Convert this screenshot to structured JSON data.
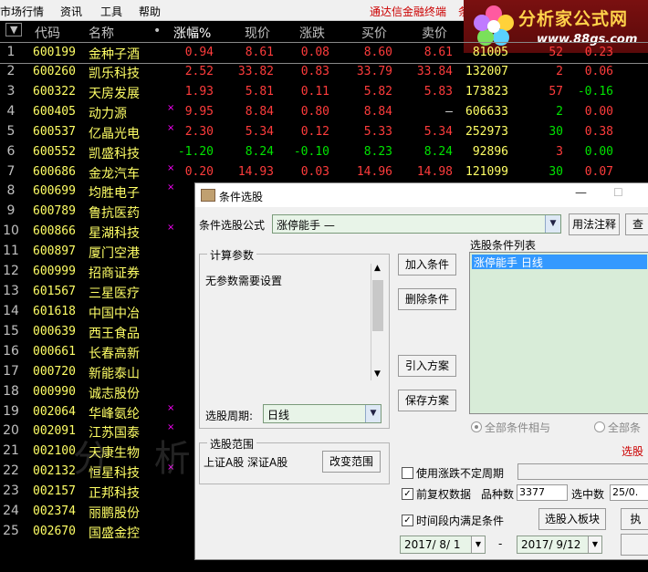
{
  "menu": {
    "items": [
      "市场行情",
      "资讯",
      "工具",
      "帮助"
    ],
    "hint": "通达信金融终端",
    "hint2": "条"
  },
  "logo": {
    "title": "分析家公式网",
    "url": "www.88gs.com"
  },
  "table": {
    "headers": [
      "▼",
      "代码",
      "名称",
      "•",
      "涨幅%",
      "现价",
      "涨跌",
      "买价",
      "卖价",
      "总量",
      "现量",
      "涨速%"
    ],
    "header_extra": "换",
    "rows": [
      {
        "idx": "1",
        "code": "600199",
        "name": "金种子酒",
        "dot": "",
        "chg": "0.94",
        "price": "8.61",
        "diff": "0.08",
        "bid": "8.60",
        "ask": "8.61",
        "vol": "81005",
        "cur": "52",
        "spd": "0.23",
        "c": "r",
        "cc": "r"
      },
      {
        "idx": "2",
        "code": "600260",
        "name": "凯乐科技",
        "dot": "",
        "chg": "2.52",
        "price": "33.82",
        "diff": "0.83",
        "bid": "33.79",
        "ask": "33.84",
        "vol": "132007",
        "cur": "2",
        "spd": "0.06",
        "c": "r",
        "cc": "r"
      },
      {
        "idx": "3",
        "code": "600322",
        "name": "天房发展",
        "dot": "",
        "chg": "1.93",
        "price": "5.81",
        "diff": "0.11",
        "bid": "5.82",
        "ask": "5.83",
        "vol": "173823",
        "cur": "57",
        "spd": "-0.16",
        "c": "r",
        "cc": "r",
        "sc": "g"
      },
      {
        "idx": "4",
        "code": "600405",
        "name": "动力源",
        "dot": "×",
        "chg": "9.95",
        "price": "8.84",
        "diff": "0.80",
        "bid": "8.84",
        "ask": "—",
        "vol": "606633",
        "cur": "2",
        "spd": "0.00",
        "c": "r",
        "cc": "g",
        "ac": "w"
      },
      {
        "idx": "5",
        "code": "600537",
        "name": "亿晶光电",
        "dot": "×",
        "chg": "2.30",
        "price": "5.34",
        "diff": "0.12",
        "bid": "5.33",
        "ask": "5.34",
        "vol": "252973",
        "cur": "30",
        "spd": "0.38",
        "c": "r",
        "cc": "g"
      },
      {
        "idx": "6",
        "code": "600552",
        "name": "凯盛科技",
        "dot": "",
        "chg": "-1.20",
        "price": "8.24",
        "diff": "-0.10",
        "bid": "8.23",
        "ask": "8.24",
        "vol": "92896",
        "cur": "3",
        "spd": "0.00",
        "c": "g",
        "cc": "r"
      },
      {
        "idx": "7",
        "code": "600686",
        "name": "金龙汽车",
        "dot": "×",
        "chg": "0.20",
        "price": "14.93",
        "diff": "0.03",
        "bid": "14.96",
        "ask": "14.98",
        "vol": "121099",
        "cur": "30",
        "spd": "0.07",
        "c": "r",
        "cc": "g"
      },
      {
        "idx": "8",
        "code": "600699",
        "name": "均胜电子",
        "dot": "×",
        "chg": "10",
        "c": "r"
      },
      {
        "idx": "9",
        "code": "600789",
        "name": "鲁抗医药",
        "dot": "",
        "chg": "-0",
        "c": "g"
      },
      {
        "idx": "10",
        "code": "600866",
        "name": "星湖科技",
        "dot": "×",
        "chg": "",
        "c": "r"
      },
      {
        "idx": "11",
        "code": "600897",
        "name": "厦门空港",
        "dot": "",
        "chg": "",
        "c": "r"
      },
      {
        "idx": "12",
        "code": "600999",
        "name": "招商证券",
        "dot": "",
        "chg": "",
        "c": "r"
      },
      {
        "idx": "13",
        "code": "601567",
        "name": "三星医疗",
        "dot": "",
        "chg": "-3",
        "c": "g"
      },
      {
        "idx": "14",
        "code": "601618",
        "name": "中国中冶",
        "dot": "",
        "chg": "",
        "c": "r"
      },
      {
        "idx": "15",
        "code": "000639",
        "name": "西王食品",
        "dot": "",
        "chg": "6",
        "c": "r"
      },
      {
        "idx": "16",
        "code": "000661",
        "name": "长春高新",
        "dot": "",
        "chg": "-1",
        "c": "g"
      },
      {
        "idx": "17",
        "code": "000720",
        "name": "新能泰山",
        "dot": "",
        "chg": "",
        "c": "r"
      },
      {
        "idx": "18",
        "code": "000990",
        "name": "诚志股份",
        "dot": "",
        "chg": "",
        "c": "r"
      },
      {
        "idx": "19",
        "code": "002064",
        "name": "华峰氨纶",
        "dot": "×",
        "chg": "",
        "c": "r"
      },
      {
        "idx": "20",
        "code": "002091",
        "name": "江苏国泰",
        "dot": "×",
        "chg": "8",
        "c": "r"
      },
      {
        "idx": "21",
        "code": "002100",
        "name": "天康生物",
        "dot": "",
        "chg": "",
        "c": "r"
      },
      {
        "idx": "22",
        "code": "002132",
        "name": "恒星科技",
        "dot": "×",
        "chg": "",
        "c": "r"
      },
      {
        "idx": "23",
        "code": "002157",
        "name": "正邦科技",
        "dot": "",
        "chg": "3",
        "c": "r"
      },
      {
        "idx": "24",
        "code": "002374",
        "name": "丽鹏股份",
        "dot": "",
        "chg": "",
        "c": "r"
      },
      {
        "idx": "25",
        "code": "002670",
        "name": "国盛金控",
        "dot": "",
        "chg": "-0",
        "c": "g"
      }
    ]
  },
  "watermark": "分 析 家 公 式 网 www.88gs.com",
  "dialog": {
    "title": "条件选股",
    "formula_label": "条件选股公式",
    "formula_value": "涨停能手    —",
    "usage_button": "用法注释",
    "view_button": "查",
    "params_group": "计算参数",
    "params_text": "无参数需要设置",
    "period_label": "选股周期:",
    "period_value": "日线",
    "add_button": "加入条件",
    "delete_button": "删除条件",
    "import_button": "引入方案",
    "save_button": "保存方案",
    "list_label": "选股条件列表",
    "list_item": "涨停能手   日线",
    "radio_all_and": "全部条件相与",
    "radio_all_or": "全部条",
    "red_hint": "选股",
    "range_group": "选股范围",
    "range_text": "上证A股 深证A股",
    "change_range_button": "改变范围",
    "uncertain_label": "使用涨跌不定周期",
    "adjust_label": "前复权数据",
    "count_label": "品种数",
    "count_value": "3377",
    "selected_label": "选中数",
    "selected_value": "25/0.",
    "period_satisfy_label": "时间段内满足条件",
    "to_block_button": "选股入板块",
    "exec_button": "执",
    "date_from": "2017/ 8/ 1",
    "date_sep": "-",
    "date_to": "2017/ 9/12"
  }
}
